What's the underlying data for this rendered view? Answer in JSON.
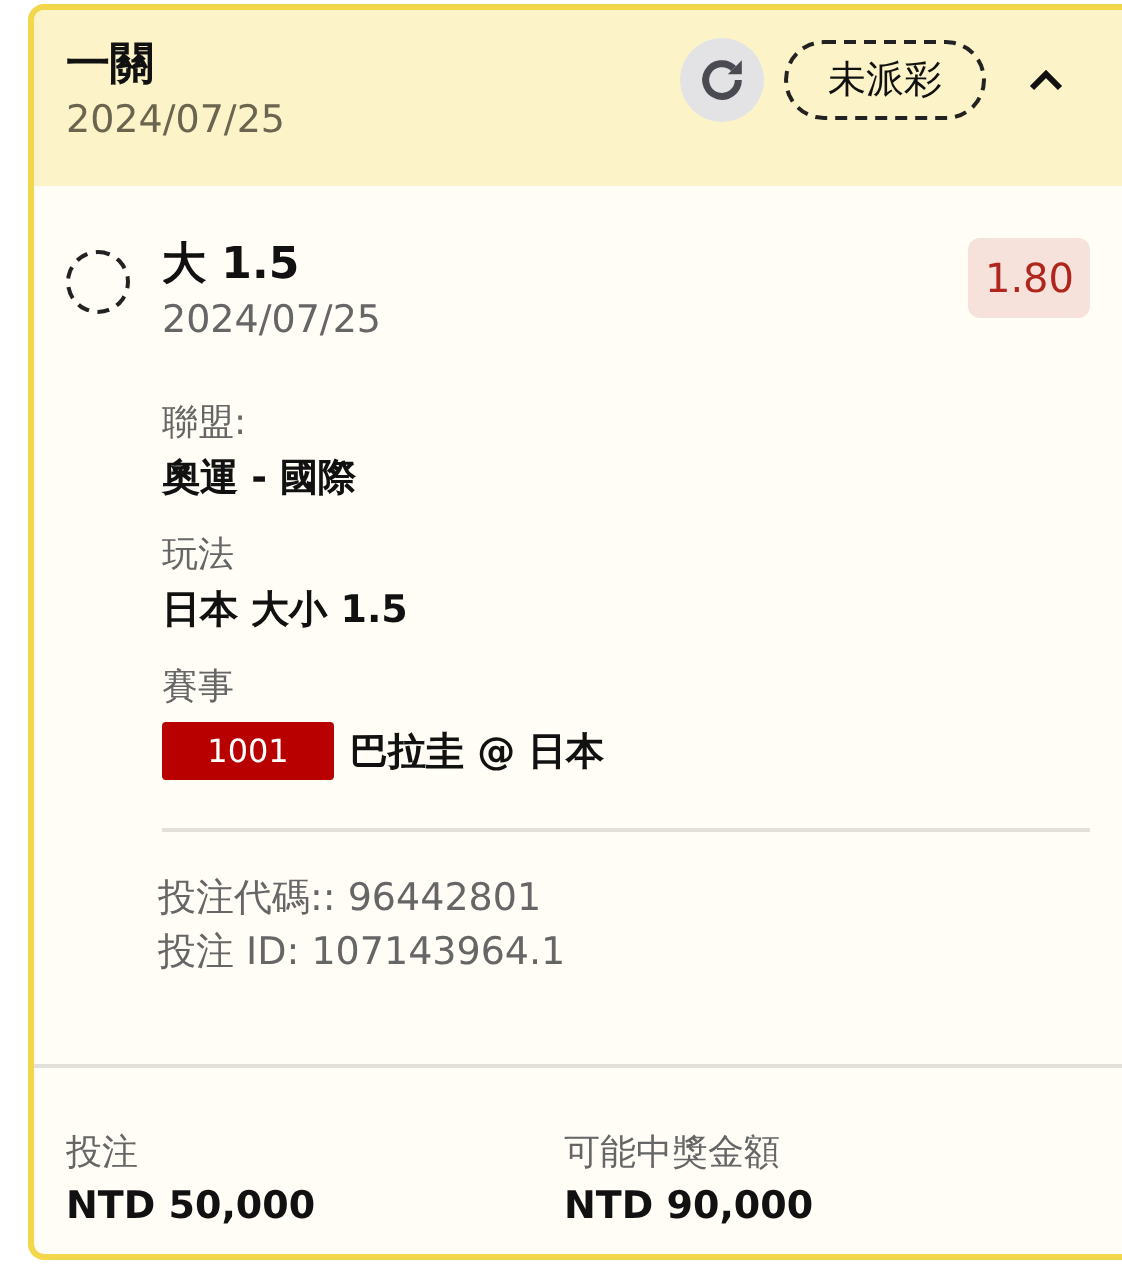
{
  "header": {
    "title": "一關",
    "date": "2024/07/25",
    "status": "未派彩",
    "expanded": true
  },
  "selection": {
    "name": "大 1.5",
    "date": "2024/07/25",
    "odds": "1.80"
  },
  "details": [
    {
      "label": "聯盟:",
      "value": "奧運 - 國際"
    },
    {
      "label": "玩法",
      "value": "日本 大小 1.5"
    },
    {
      "label": "賽事",
      "event_code": "1001",
      "value": "巴拉圭 @ 日本"
    }
  ],
  "bet_info": [
    "投注代碼:: 96442801",
    "投注 ID: 107143964.1"
  ],
  "summary": [
    {
      "label": "投注",
      "value": "NTD 50,000"
    },
    {
      "label": "可能中獎金額",
      "value": "NTD 90,000"
    }
  ]
}
